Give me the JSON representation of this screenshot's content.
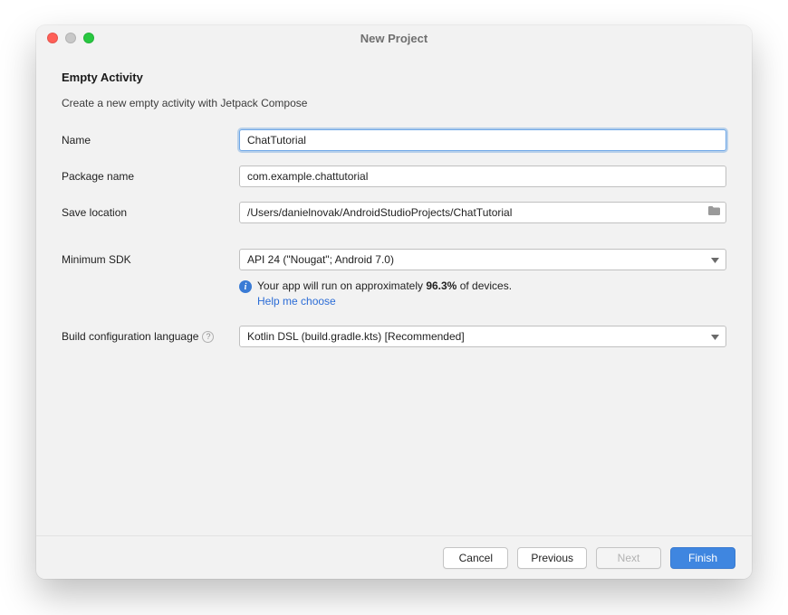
{
  "window": {
    "title": "New Project"
  },
  "page": {
    "heading": "Empty Activity",
    "description": "Create a new empty activity with Jetpack Compose"
  },
  "fields": {
    "name": {
      "label": "Name",
      "value": "ChatTutorial"
    },
    "package_name": {
      "label": "Package name",
      "value": "com.example.chattutorial"
    },
    "save_location": {
      "label": "Save location",
      "value": "/Users/danielnovak/AndroidStudioProjects/ChatTutorial"
    },
    "minimum_sdk": {
      "label": "Minimum SDK",
      "value": "API 24 (\"Nougat\"; Android 7.0)"
    },
    "build_language": {
      "label": "Build configuration language",
      "value": "Kotlin DSL (build.gradle.kts) [Recommended]"
    }
  },
  "hint": {
    "text_pre": "Your app will run on approximately ",
    "percent": "96.3%",
    "text_post": " of devices.",
    "link": "Help me choose"
  },
  "buttons": {
    "cancel": "Cancel",
    "previous": "Previous",
    "next": "Next",
    "finish": "Finish"
  }
}
